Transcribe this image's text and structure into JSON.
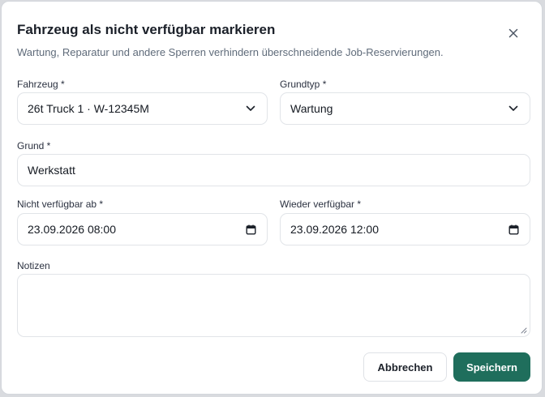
{
  "dialog": {
    "title": "Fahrzeug als nicht verfügbar markieren",
    "subtitle": "Wartung, Reparatur und andere Sperren verhindern überschneidende Job-Reservierungen.",
    "close_icon": "close-icon"
  },
  "form": {
    "vehicle": {
      "label": "Fahrzeug *",
      "value": "26t Truck 1 · W-12345M",
      "icon": "chevron-down-icon"
    },
    "reason_type": {
      "label": "Grundtyp *",
      "value": "Wartung",
      "icon": "chevron-down-icon"
    },
    "reason": {
      "label": "Grund *",
      "value": "Werkstatt"
    },
    "unavailable_from": {
      "label": "Nicht verfügbar ab *",
      "value": "23.09.2026 08:00",
      "icon": "calendar-icon"
    },
    "available_again": {
      "label": "Wieder verfügbar *",
      "value": "23.09.2026 12:00",
      "icon": "calendar-icon"
    },
    "notes": {
      "label": "Notizen",
      "value": ""
    }
  },
  "buttons": {
    "cancel": "Abbrechen",
    "save": "Speichern"
  },
  "colors": {
    "primary": "#1f6e5c",
    "border": "#e1e4e8",
    "text": "#1b2029",
    "muted": "#5f6b7a"
  }
}
